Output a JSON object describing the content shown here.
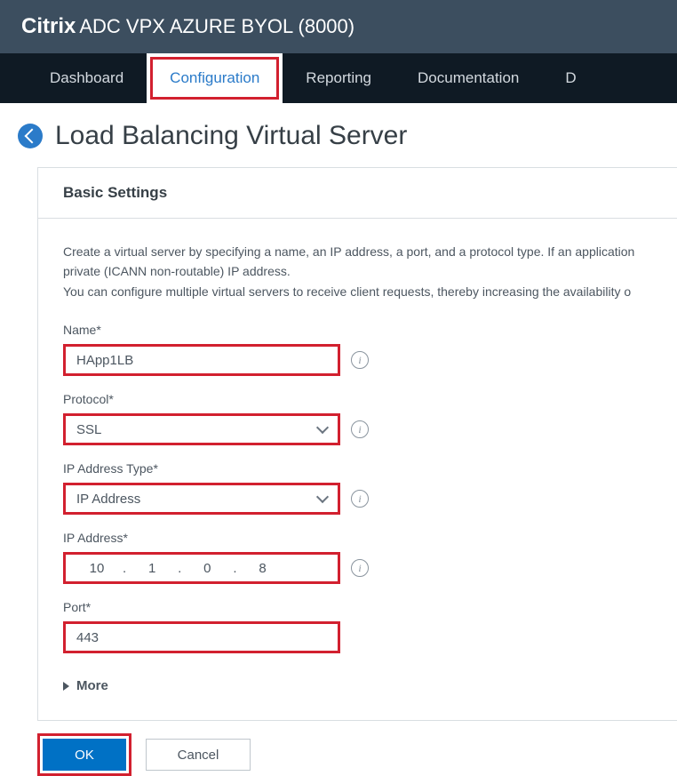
{
  "header": {
    "brand_strong": "Citrix",
    "brand_rest": "ADC VPX AZURE BYOL (8000)"
  },
  "nav": {
    "items": [
      "Dashboard",
      "Configuration",
      "Reporting",
      "Documentation",
      "D"
    ],
    "active_index": 1
  },
  "page": {
    "title": "Load Balancing Virtual Server"
  },
  "panel": {
    "header": "Basic Settings",
    "intro_line1": "Create a virtual server by specifying a name, an IP address, a port, and a protocol type. If an application",
    "intro_line2": "private (ICANN non-routable) IP address.",
    "intro_line3": "You can configure multiple virtual servers to receive client requests, thereby increasing the availability o"
  },
  "form": {
    "name_label": "Name*",
    "name_value": "HApp1LB",
    "protocol_label": "Protocol*",
    "protocol_value": "SSL",
    "iptype_label": "IP Address Type*",
    "iptype_value": "IP Address",
    "ipaddr_label": "IP Address*",
    "ip": {
      "a": "10",
      "b": "1",
      "c": "0",
      "d": "8"
    },
    "port_label": "Port*",
    "port_value": "443",
    "more_label": "More"
  },
  "buttons": {
    "ok": "OK",
    "cancel": "Cancel"
  }
}
